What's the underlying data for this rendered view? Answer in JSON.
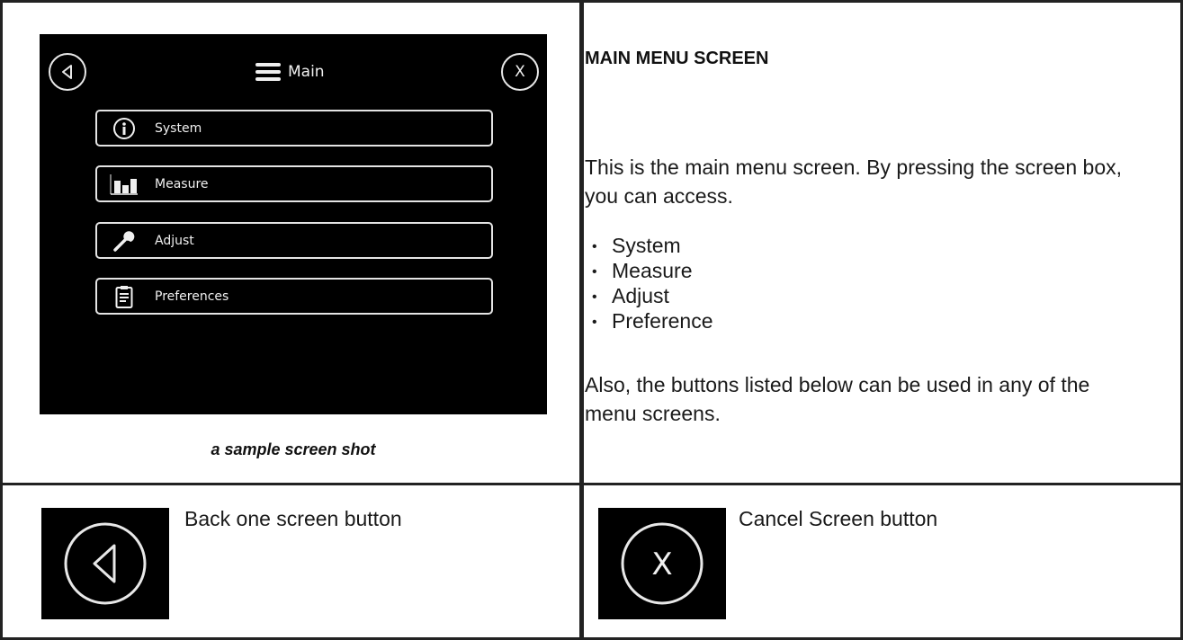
{
  "screen": {
    "title": "Main",
    "back_icon": "back-triangle-icon",
    "cancel_label": "X",
    "menu": [
      {
        "label": "System",
        "icon": "info-icon"
      },
      {
        "label": "Measure",
        "icon": "bar-chart-icon"
      },
      {
        "label": "Adjust",
        "icon": "wrench-icon"
      },
      {
        "label": "Preferences",
        "icon": "clipboard-icon"
      }
    ]
  },
  "caption": "a sample screen shot",
  "description": {
    "heading": "MAIN MENU SCREEN",
    "intro": "This is the main menu screen. By pressing the screen box, you can access.",
    "items": [
      "System",
      "Measure",
      "Adjust",
      "Preference"
    ],
    "outro": "Also, the buttons listed below can be used in any of the menu screens."
  },
  "legend": {
    "back": {
      "label": "Back one screen button",
      "icon": "back-triangle-icon"
    },
    "cancel": {
      "label": "Cancel Screen button",
      "icon_text": "X"
    }
  },
  "colors": {
    "screen_bg": "#000000",
    "screen_fg": "#e8e8e8",
    "border": "#222222"
  }
}
